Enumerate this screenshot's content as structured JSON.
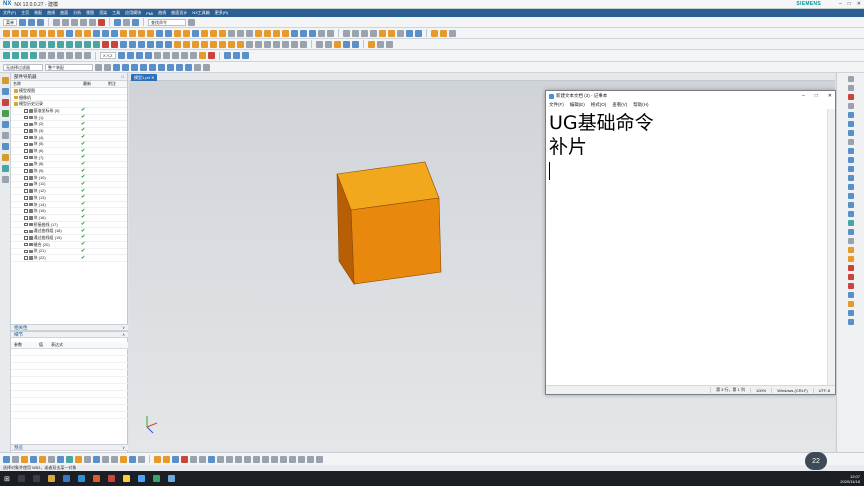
{
  "window": {
    "app_logo": "NX",
    "title": "NX 12.0.0.27 - 建模",
    "brand": "SIEMENS"
  },
  "menu": [
    "文件(F)",
    "主页",
    "装配",
    "曲线",
    "曲面",
    "分析",
    "视图",
    "渲染",
    "工具",
    "应用模块",
    "PMI",
    "曲线",
    "曲面设计",
    "NX工具箱",
    "更多(R)"
  ],
  "toolbar": {
    "menu_button": "菜单",
    "command_search_placeholder": "查找命令",
    "filter_select": "无选择过滤器",
    "assembly_select": "整个装配"
  },
  "navigator": {
    "title": "部件导航器",
    "columns": [
      "名称",
      "最新",
      "附注"
    ],
    "items": [
      {
        "name": "模型视图",
        "kind": "folder",
        "check": false
      },
      {
        "name": "摄像机",
        "kind": "folder",
        "check": false
      },
      {
        "name": "模型历史记录",
        "kind": "folder",
        "check": false
      },
      {
        "name": "基准坐标系 (0)",
        "kind": "feature",
        "check": true
      },
      {
        "name": "块 (1)",
        "kind": "feature",
        "check": true
      },
      {
        "name": "块 (2)",
        "kind": "feature",
        "check": true
      },
      {
        "name": "块 (3)",
        "kind": "feature",
        "check": true
      },
      {
        "name": "块 (4)",
        "kind": "feature",
        "check": true
      },
      {
        "name": "块 (5)",
        "kind": "feature",
        "check": true
      },
      {
        "name": "块 (6)",
        "kind": "feature",
        "check": true
      },
      {
        "name": "块 (7)",
        "kind": "feature",
        "check": true
      },
      {
        "name": "块 (8)",
        "kind": "feature",
        "check": true
      },
      {
        "name": "块 (9)",
        "kind": "feature",
        "check": true
      },
      {
        "name": "块 (10)",
        "kind": "feature",
        "check": true
      },
      {
        "name": "块 (11)",
        "kind": "feature",
        "check": true
      },
      {
        "name": "块 (12)",
        "kind": "feature",
        "check": true
      },
      {
        "name": "块 (13)",
        "kind": "feature",
        "check": true
      },
      {
        "name": "块 (14)",
        "kind": "feature",
        "check": true
      },
      {
        "name": "块 (15)",
        "kind": "feature",
        "check": true
      },
      {
        "name": "块 (16)",
        "kind": "feature",
        "check": true
      },
      {
        "name": "桥接曲线 (17)",
        "kind": "feature",
        "check": true
      },
      {
        "name": "通过曲线组 (18)",
        "kind": "feature",
        "check": true
      },
      {
        "name": "通过曲线组 (19)",
        "kind": "feature",
        "check": true
      },
      {
        "name": "缝合 (20)",
        "kind": "feature",
        "check": true
      },
      {
        "name": "块 (21)",
        "kind": "feature",
        "check": true
      },
      {
        "name": "块 (22)",
        "kind": "feature",
        "check": true
      }
    ],
    "dependencies_label": "相关性",
    "details_label": "细节",
    "details_columns": [
      "参数",
      "值",
      "表达式"
    ],
    "preview_label": "预览"
  },
  "viewport": {
    "tab_label": "模型1.prt",
    "cube_colors": {
      "top": "#f2a81c",
      "front": "#e8890e",
      "side": "#b85f06"
    }
  },
  "notepad": {
    "title": "新建文本文档 (3) - 记事本",
    "menu": [
      "文件(F)",
      "编辑(E)",
      "格式(O)",
      "查看(V)",
      "帮助(H)"
    ],
    "lines": [
      "UG基础命令",
      "补片"
    ],
    "status": {
      "position": "第 3 行，第 1 列",
      "zoom": "100%",
      "line_ending": "Windows (CRLF)",
      "encoding": "UTF-8"
    }
  },
  "statusbar": {
    "message": "选择对象并使用 MB3，或者双击某一对象"
  },
  "taskbar": {
    "time": "12:07",
    "date": "2020/11/18",
    "bubble_value": "22"
  }
}
